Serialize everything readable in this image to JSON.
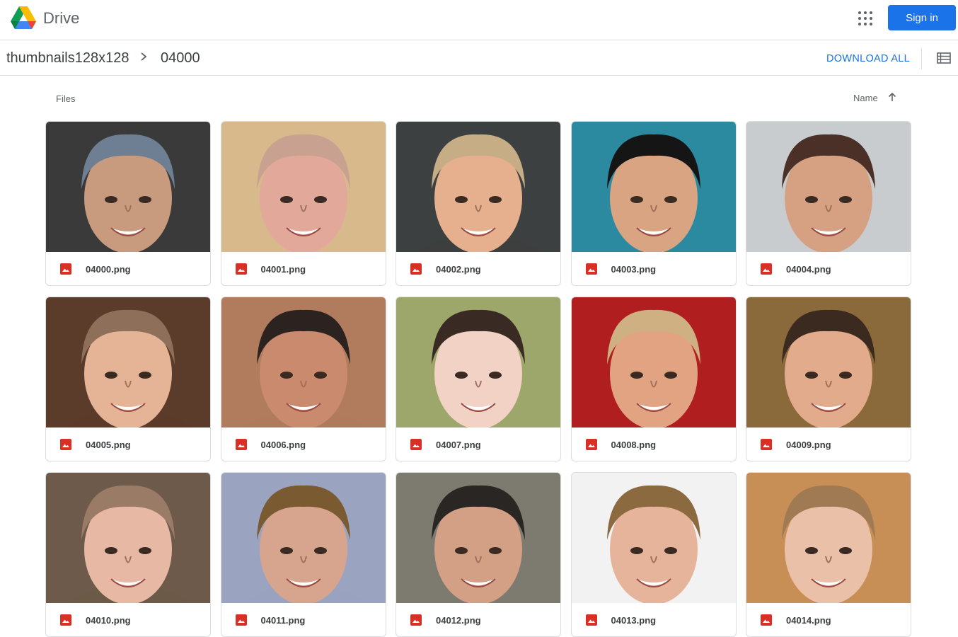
{
  "app": {
    "brand": "Drive",
    "signin_label": "Sign in"
  },
  "breadcrumb": {
    "parent": "thumbnails128x128",
    "current": "04000"
  },
  "toolbar": {
    "download_all": "DOWNLOAD ALL"
  },
  "section": {
    "label": "Files",
    "sort_label": "Name"
  },
  "files": [
    {
      "name": "04000.png",
      "bg": "#3b3a3a",
      "skin": "#c89a7e",
      "hair": "#6f7f93"
    },
    {
      "name": "04001.png",
      "bg": "#d8b98c",
      "skin": "#e2a89a",
      "hair": "#c9a191"
    },
    {
      "name": "04002.png",
      "bg": "#3d4040",
      "skin": "#e6b08e",
      "hair": "#c7ad85"
    },
    {
      "name": "04003.png",
      "bg": "#2b8aa0",
      "skin": "#d9a482",
      "hair": "#151515"
    },
    {
      "name": "04004.png",
      "bg": "#c9cccf",
      "skin": "#d6a083",
      "hair": "#4a3026"
    },
    {
      "name": "04005.png",
      "bg": "#5b3b29",
      "skin": "#e5b396",
      "hair": "#8d6f5a"
    },
    {
      "name": "04006.png",
      "bg": "#b07c5d",
      "skin": "#c98a6e",
      "hair": "#2c2320"
    },
    {
      "name": "04007.png",
      "bg": "#9ea76b",
      "skin": "#f1d2c4",
      "hair": "#3a2a24"
    },
    {
      "name": "04008.png",
      "bg": "#b01e1f",
      "skin": "#e2a382",
      "hair": "#cfb083"
    },
    {
      "name": "04009.png",
      "bg": "#8a6a3a",
      "skin": "#e1ab8c",
      "hair": "#3a2a20"
    },
    {
      "name": "04010.png",
      "bg": "#6d5a4a",
      "skin": "#e7b8a3",
      "hair": "#9a7c66"
    },
    {
      "name": "04011.png",
      "bg": "#9aa3bf",
      "skin": "#d7a58e",
      "hair": "#7a5a30"
    },
    {
      "name": "04012.png",
      "bg": "#7d7a70",
      "skin": "#d3a086",
      "hair": "#2a2624"
    },
    {
      "name": "04013.png",
      "bg": "#f2f2f2",
      "skin": "#e6b49a",
      "hair": "#8c6a40"
    },
    {
      "name": "04014.png",
      "bg": "#c78e55",
      "skin": "#eac1a8",
      "hair": "#a07a52"
    }
  ]
}
